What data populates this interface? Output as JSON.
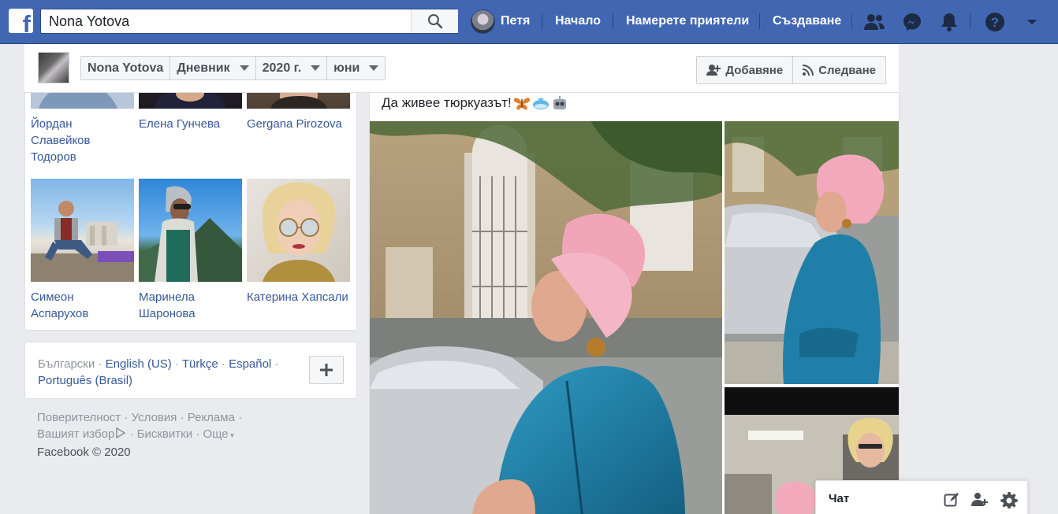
{
  "topbar": {
    "search_value": "Nona Yotova",
    "user_name": "Петя",
    "nav_home": "Начало",
    "nav_find_friends": "Намерете приятели",
    "nav_create": "Създаване"
  },
  "profile_bar": {
    "name": "Nona Yotova",
    "timeline": "Дневник",
    "year": "2020 г.",
    "month": "юни",
    "add_friend": "Добавяне",
    "follow": "Следване"
  },
  "friends": [
    {
      "name": "Йордан Славейков Тодоров"
    },
    {
      "name": "Елена Гунчева"
    },
    {
      "name": "Gergana Pirozova"
    },
    {
      "name": "Симеон Аспарухов"
    },
    {
      "name": "Маринела Шаронова"
    },
    {
      "name": "Катерина Хапсали"
    }
  ],
  "languages": {
    "current": "Български",
    "sep": "·",
    "others": [
      "English (US)",
      "Türkçe",
      "Español",
      "Português (Brasil)"
    ]
  },
  "footer": {
    "privacy": "Поверителност",
    "terms": "Условия",
    "ads": "Реклама",
    "ad_choices": "Вашият избор",
    "cookies": "Бисквитки",
    "more": "Още",
    "copyright": "Facebook © 2020"
  },
  "post": {
    "text": "Да живее тюркуазът!"
  },
  "chat": {
    "label": "Чат"
  },
  "colors": {
    "brand": "#4267b2",
    "link": "#365899",
    "muted": "#90949c"
  }
}
